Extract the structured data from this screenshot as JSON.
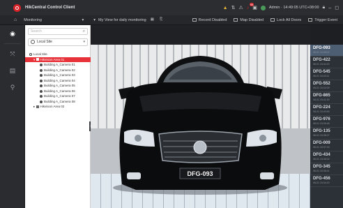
{
  "app": {
    "title": "HikCentral Control Client",
    "user_info": "Admin · 14:49:05 UTC+08:00"
  },
  "toolbar": {
    "module": "Monitoring",
    "module_caret": "▾",
    "view_name": "My View for daily monitoring",
    "view_caret": "▾",
    "actions": [
      {
        "label": "Record Disabled"
      },
      {
        "label": "Map Disabled"
      },
      {
        "label": "Lock All Doors"
      },
      {
        "label": "Trigger Event"
      }
    ]
  },
  "panel": {
    "search_placeholder": "Search",
    "site": "Local Site",
    "tree": {
      "root": "Local Site",
      "selected_area": "Hikvision Area 01",
      "cameras": [
        "Building A_Camera 01",
        "Building A_Camera 02",
        "Building A_Camera 03",
        "Building A_Camera 04",
        "Building A_Camera 05",
        "Building A_Camera 06",
        "Building A_Camera 07",
        "Building A_Camera 08"
      ],
      "other_area": "Hikvision Area 02"
    }
  },
  "video": {
    "plate_on_car": "DFG-093"
  },
  "plates": [
    {
      "num": "DFG-093",
      "meta": "08-01 15:45:02"
    },
    {
      "num": "DFG-422",
      "meta": "08-01 15:44:20"
    },
    {
      "num": "DFG-545",
      "meta": "08-01 15:43:11"
    },
    {
      "num": "DFG-552",
      "meta": "08-01 15:42:09"
    },
    {
      "num": "DFG-865",
      "meta": "08-01 15:41:30"
    },
    {
      "num": "DFG-224",
      "meta": "08-01 15:40:55"
    },
    {
      "num": "DFG-976",
      "meta": "08-01 15:39:48"
    },
    {
      "num": "DFG-135",
      "meta": "08-01 15:38:27"
    },
    {
      "num": "DFG-009",
      "meta": "08-01 15:37:16"
    },
    {
      "num": "DFG-434",
      "meta": "08-01 15:36:02"
    },
    {
      "num": "DFG-345",
      "meta": "08-01 15:35:41"
    },
    {
      "num": "DFG-456",
      "meta": "08-01 15:34:20"
    }
  ],
  "colors": {
    "accent_red": "#e8323a",
    "active_plate": "#4d5d72"
  }
}
